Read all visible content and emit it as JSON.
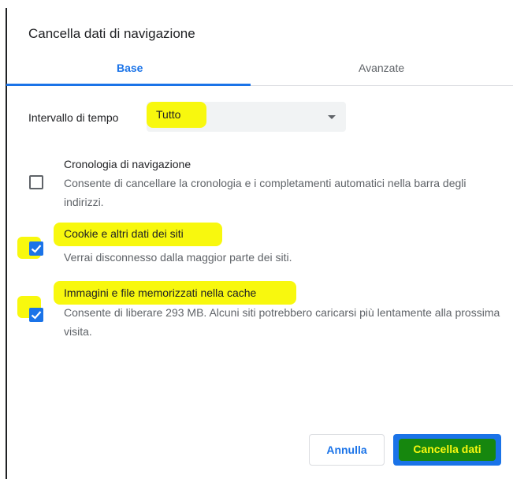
{
  "dialog": {
    "title": "Cancella dati di navigazione"
  },
  "tabs": {
    "base": "Base",
    "advanced": "Avanzate",
    "active": "base"
  },
  "time_range": {
    "label": "Intervallo di tempo",
    "selected": "Tutto"
  },
  "items": [
    {
      "title": "Cronologia di navigazione",
      "description": "Consente di cancellare la cronologia e i completamenti automatici nella barra degli indirizzi.",
      "checked": false
    },
    {
      "title": "Cookie e altri dati dei siti",
      "description": "Verrai disconnesso dalla maggior parte dei siti.",
      "checked": true
    },
    {
      "title": "Immagini e file memorizzati nella cache",
      "description": "Consente di liberare 293 MB. Alcuni siti potrebbero caricarsi più lentamente alla prossima visita.",
      "checked": true
    }
  ],
  "buttons": {
    "cancel": "Annulla",
    "clear": "Cancella dati"
  },
  "colors": {
    "accent": "#1a73e8",
    "highlight": "#f8f80e",
    "highlight_dark": "#16870e",
    "text": "#202124",
    "secondary_text": "#5f6368",
    "divider": "#dadce0"
  },
  "icons": {
    "dropdown": "caret-down-icon",
    "checked": "checkmark-icon"
  }
}
